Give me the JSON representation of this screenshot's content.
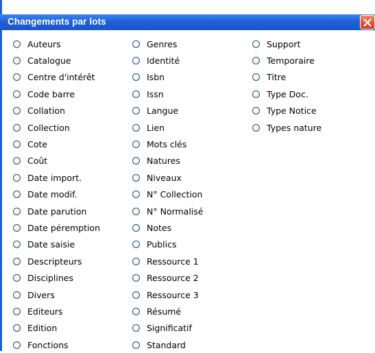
{
  "window": {
    "title": "Changements par lots"
  },
  "options": {
    "col1": [
      "Auteurs",
      "Catalogue",
      "Centre d'intérêt",
      "Code barre",
      "Collation",
      "Collection",
      "Cote",
      "Coût",
      "Date import.",
      "Date modif.",
      "Date parution",
      "Date péremption",
      "Date saisie",
      "Descripteurs",
      "Disciplines",
      "Divers",
      "Editeurs",
      "Edition",
      "Fonctions"
    ],
    "col2": [
      "Genres",
      "Identité",
      "Isbn",
      "Issn",
      "Langue",
      "Lien",
      "Mots clés",
      "Natures",
      "Niveaux",
      "N° Collection",
      "N° Normalisé",
      "Notes",
      "Publics",
      "Ressource 1",
      "Ressource 2",
      "Ressource 3",
      "Résumé",
      "Significatif",
      "Standard"
    ],
    "col3": [
      "Support",
      "Temporaire",
      "Titre",
      "Type Doc.",
      "Type Notice",
      "Types nature"
    ]
  },
  "colors": {
    "titlebar": "#1e5fd7",
    "close": "#e0502c",
    "radio_border": "#1c5180"
  },
  "icons": {
    "close": "close-icon",
    "radio": "radio-button-icon"
  }
}
